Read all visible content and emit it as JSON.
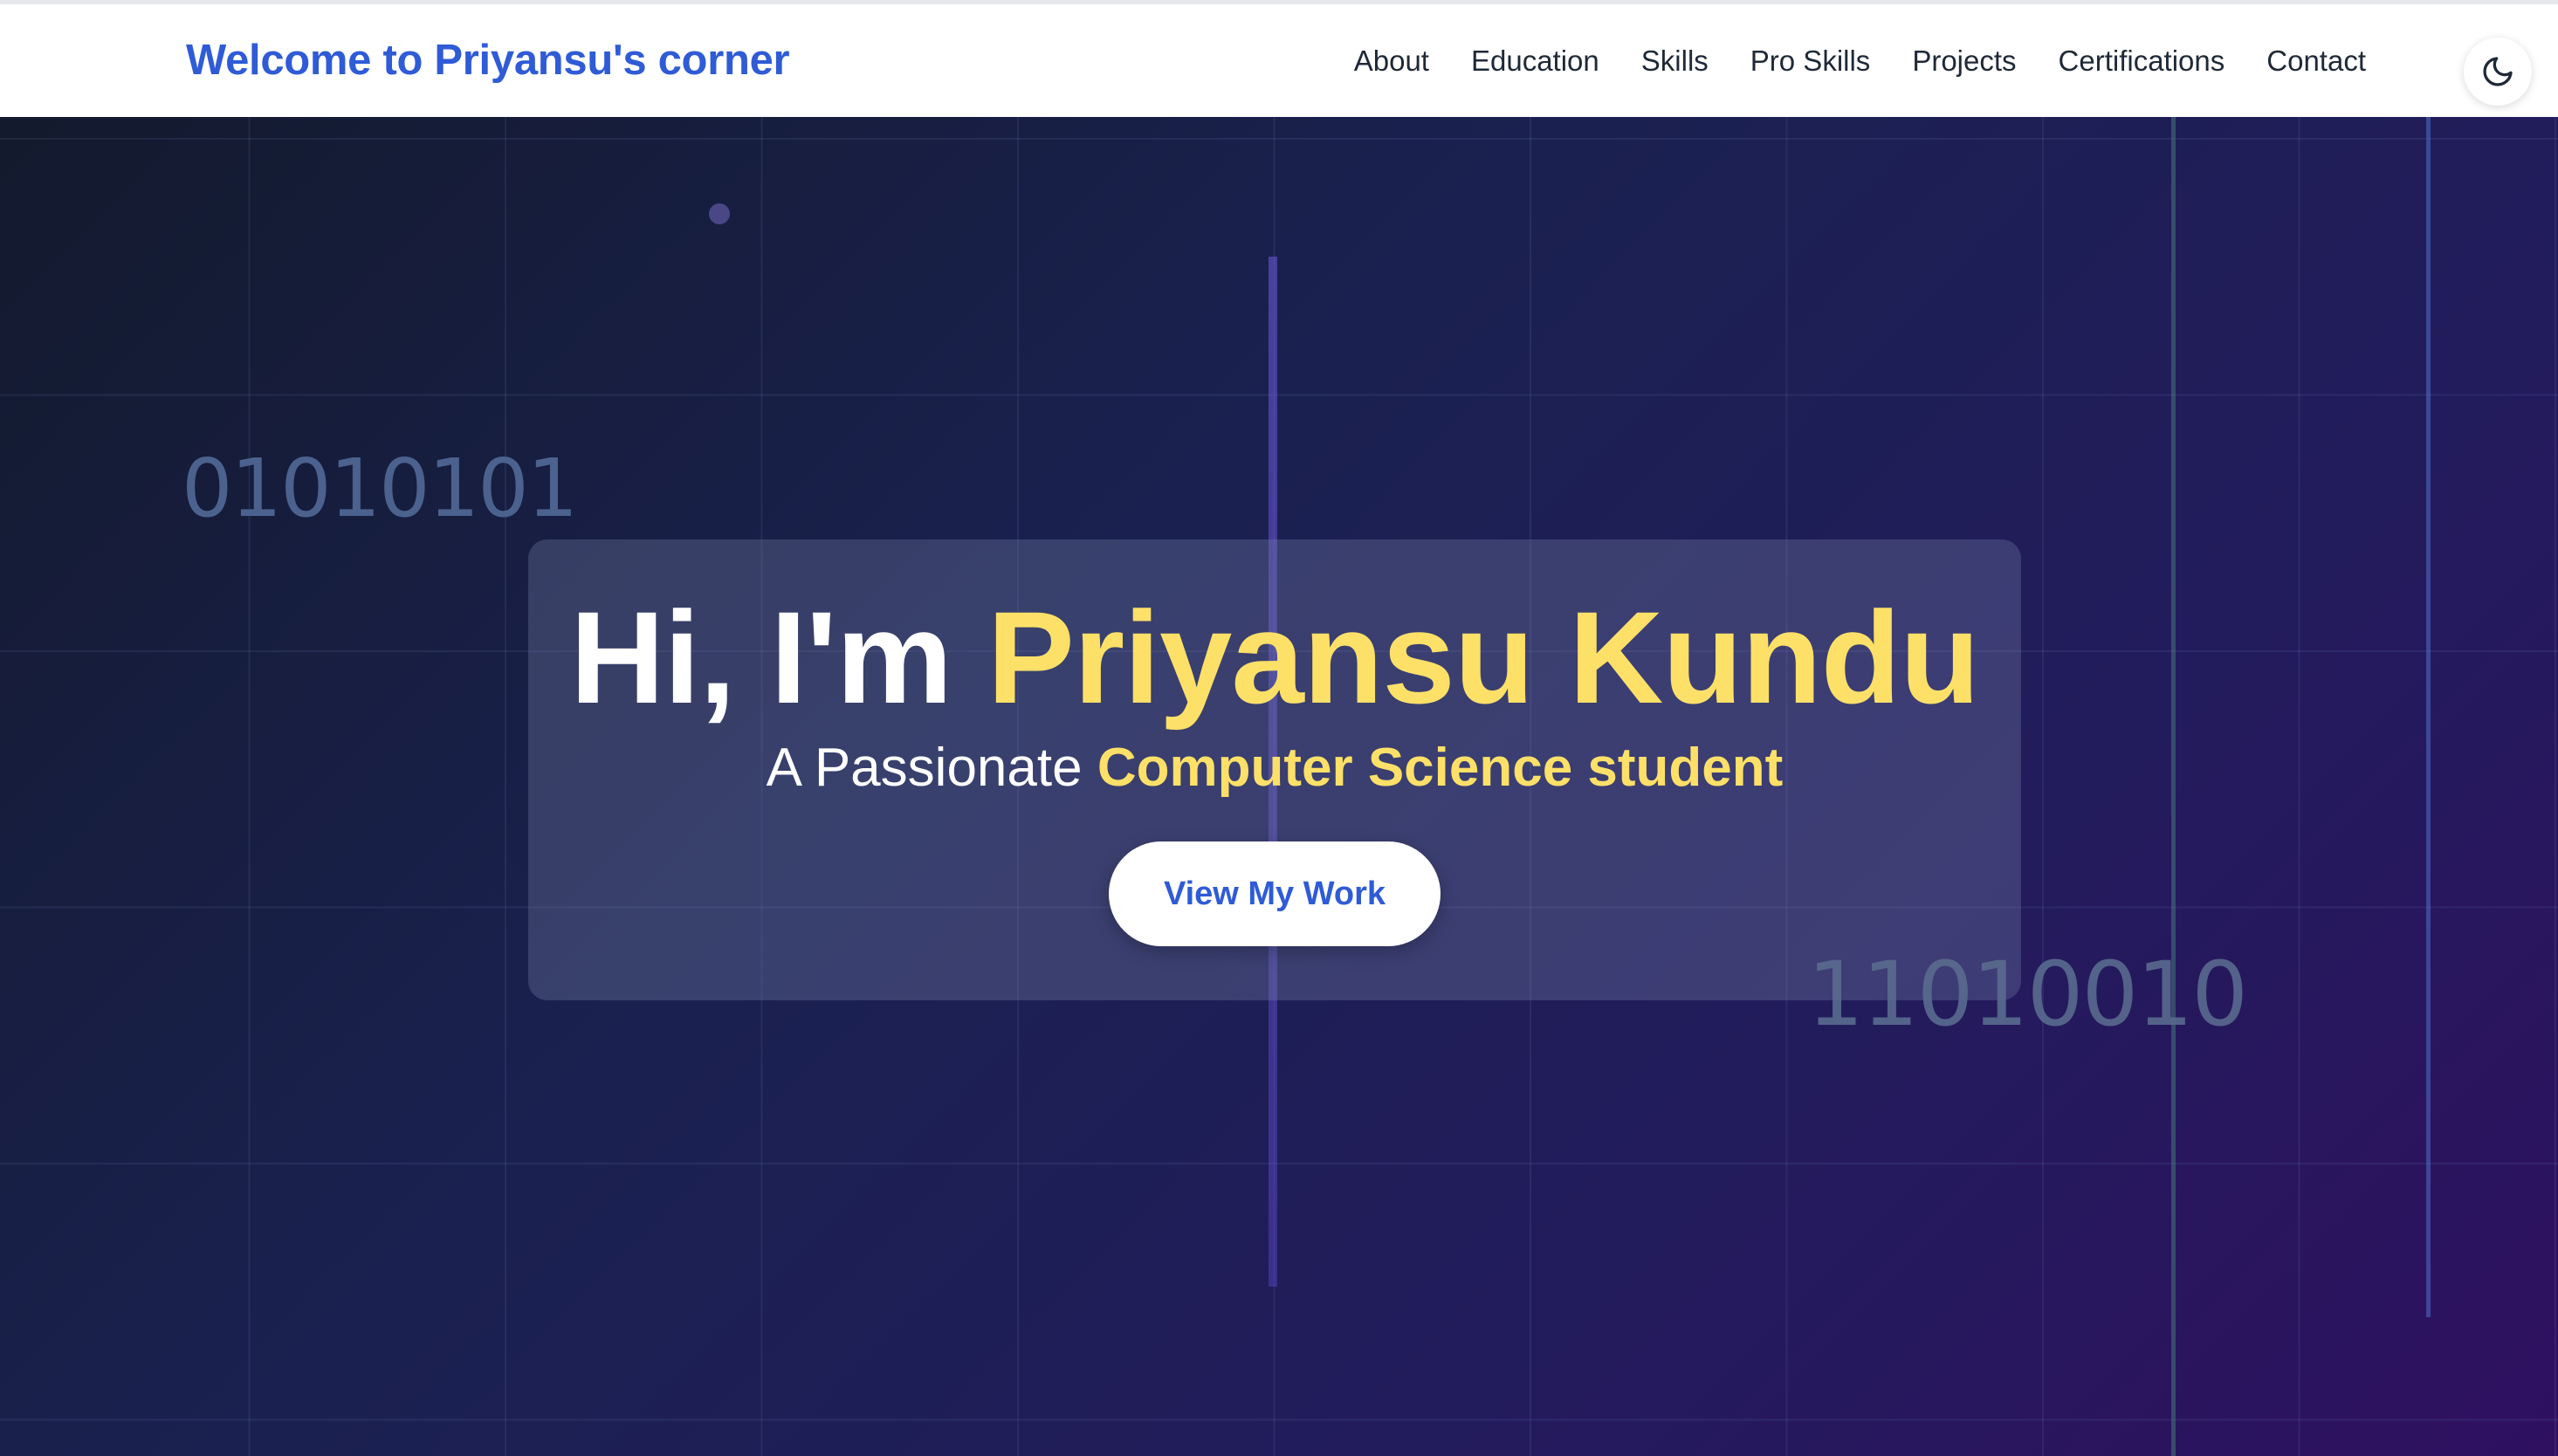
{
  "navbar": {
    "brand": "Welcome to Priyansu's corner",
    "links": [
      "About",
      "Education",
      "Skills",
      "Pro Skills",
      "Projects",
      "Certifications",
      "Contact"
    ],
    "theme_toggle_icon": "moon-icon"
  },
  "hero": {
    "greeting": "Hi, I'm ",
    "name": "Priyansu Kundu",
    "subtitle_prefix": "A Passionate ",
    "subtitle_highlight": "Computer Science student",
    "cta_label": "View My Work",
    "binary_left": "01010101",
    "binary_right": "11010010"
  },
  "colors": {
    "brand": "#2f5bd6",
    "accent": "#fde068",
    "hero_bg_start": "#131a2d",
    "hero_bg_end": "#2f1060"
  }
}
